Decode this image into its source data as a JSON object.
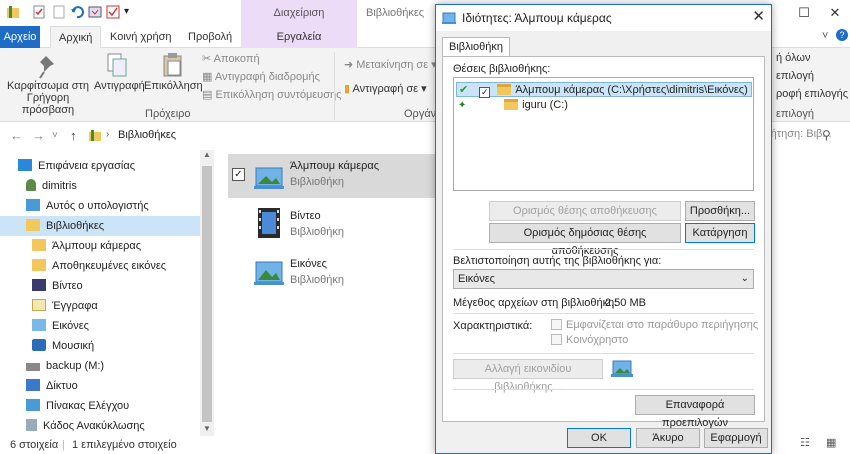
{
  "explorer": {
    "context_group": "Διαχείριση",
    "window_title": "Βιβλιοθήκες",
    "window_controls": {
      "minimize": "—",
      "maximize": "☐",
      "close": "✕"
    },
    "tabs": [
      "Αρχείο",
      "Αρχική",
      "Κοινή χρήση",
      "Προβολή",
      "Εργαλεία βιβλιοθήκης"
    ],
    "ribbon": {
      "pin_label": "Καρφίτσωμα στη Γρήγορη πρόσβαση",
      "copy_label": "Αντιγραφή",
      "paste_label": "Επικόλληση",
      "cut_label": "Αποκοπή",
      "copy_path_label": "Αντιγραφή διαδρομής",
      "paste_shortcut_label": "Επικόλληση συντόμευσης",
      "clipboard_group": "Πρόχειρο",
      "move_to_label": "Μετακίνηση σε",
      "copy_to_label": "Αντιγραφή σε",
      "organize_group": "Οργάν",
      "select_all_partial": "ή όλων",
      "select_none_partial": "επιλογή",
      "invert_selection_partial": "ροφή επιλογής",
      "select_group_partial": "επιλογή"
    },
    "address": {
      "path": "Βιβλιοθήκες",
      "search_placeholder": "ζήτηση: Βιβ..."
    },
    "nav": {
      "items": [
        {
          "label": "Επιφάνεια εργασίας",
          "icon": "desktop-icon"
        },
        {
          "label": "dimitris",
          "icon": "user-icon"
        },
        {
          "label": "Αυτός ο υπολογιστής",
          "icon": "computer-icon"
        },
        {
          "label": "Βιβλιοθήκες",
          "icon": "libraries-icon"
        },
        {
          "label": "Άλμπουμ κάμερας",
          "icon": "library-icon"
        },
        {
          "label": "Αποθηκευμένες εικόνες",
          "icon": "library-icon"
        },
        {
          "label": "Βίντεο",
          "icon": "video-icon"
        },
        {
          "label": "Έγγραφα",
          "icon": "documents-icon"
        },
        {
          "label": "Εικόνες",
          "icon": "pictures-icon"
        },
        {
          "label": "Μουσική",
          "icon": "music-icon"
        },
        {
          "label": "backup (M:)",
          "icon": "drive-icon"
        },
        {
          "label": "Δίκτυο",
          "icon": "network-icon"
        },
        {
          "label": "Πίνακας Ελέγχου",
          "icon": "control-panel-icon"
        },
        {
          "label": "Κάδος Ανακύκλωσης",
          "icon": "recycle-bin-icon"
        }
      ]
    },
    "content": {
      "items": [
        {
          "name": "Άλμπουμ κάμερας",
          "type": "Βιβλιοθήκη"
        },
        {
          "name": "Βίντεο",
          "type": "Βιβλιοθήκη"
        },
        {
          "name": "Εικόνες",
          "type": "Βιβλιοθήκη"
        }
      ]
    },
    "status": {
      "count": "6 στοιχεία",
      "selected": "1 επιλεγμένο στοιχείο"
    }
  },
  "dialog": {
    "title": "Ιδιότητες: Άλμπουμ κάμερας",
    "close": "✕",
    "tab": "Βιβλιοθήκη",
    "locations_label": "Θέσεις βιβλιοθήκης:",
    "locations": [
      {
        "label": "Άλμπουμ κάμερας (C:\\Χρήστες\\dimitris\\Εικόνες)"
      },
      {
        "label": "iguru (C:)"
      }
    ],
    "btn_set_save": "Ορισμός θέσης αποθήκευσης",
    "btn_add": "Προσθήκη...",
    "btn_set_public_save": "Ορισμός δημόσιας θέσης αποθήκευσης",
    "btn_remove": "Κατάργηση",
    "optimize_label": "Βελτιστοποίηση αυτής της βιβλιοθήκης για:",
    "optimize_value": "Εικόνες",
    "size_label": "Μέγεθος αρχείων στη βιβλιοθήκη:",
    "size_value": "2,50 MB",
    "attributes_label": "Χαρακτηριστικά:",
    "attr_shown_nav": "Εμφανίζεται στο παράθυρο περιήγησης",
    "attr_shared": "Κοινόχρηστο",
    "btn_change_icon": "Αλλαγή εικονιδίου βιβλιοθήκης...",
    "btn_restore_defaults": "Επαναφορά προεπιλογών",
    "btn_ok": "OK",
    "btn_cancel": "Άκυρο",
    "btn_apply": "Εφαρμογή"
  },
  "colors": {
    "accent": "#1e6cc6",
    "context_tab": "#eddcf7",
    "selection": "#cce4f7"
  }
}
